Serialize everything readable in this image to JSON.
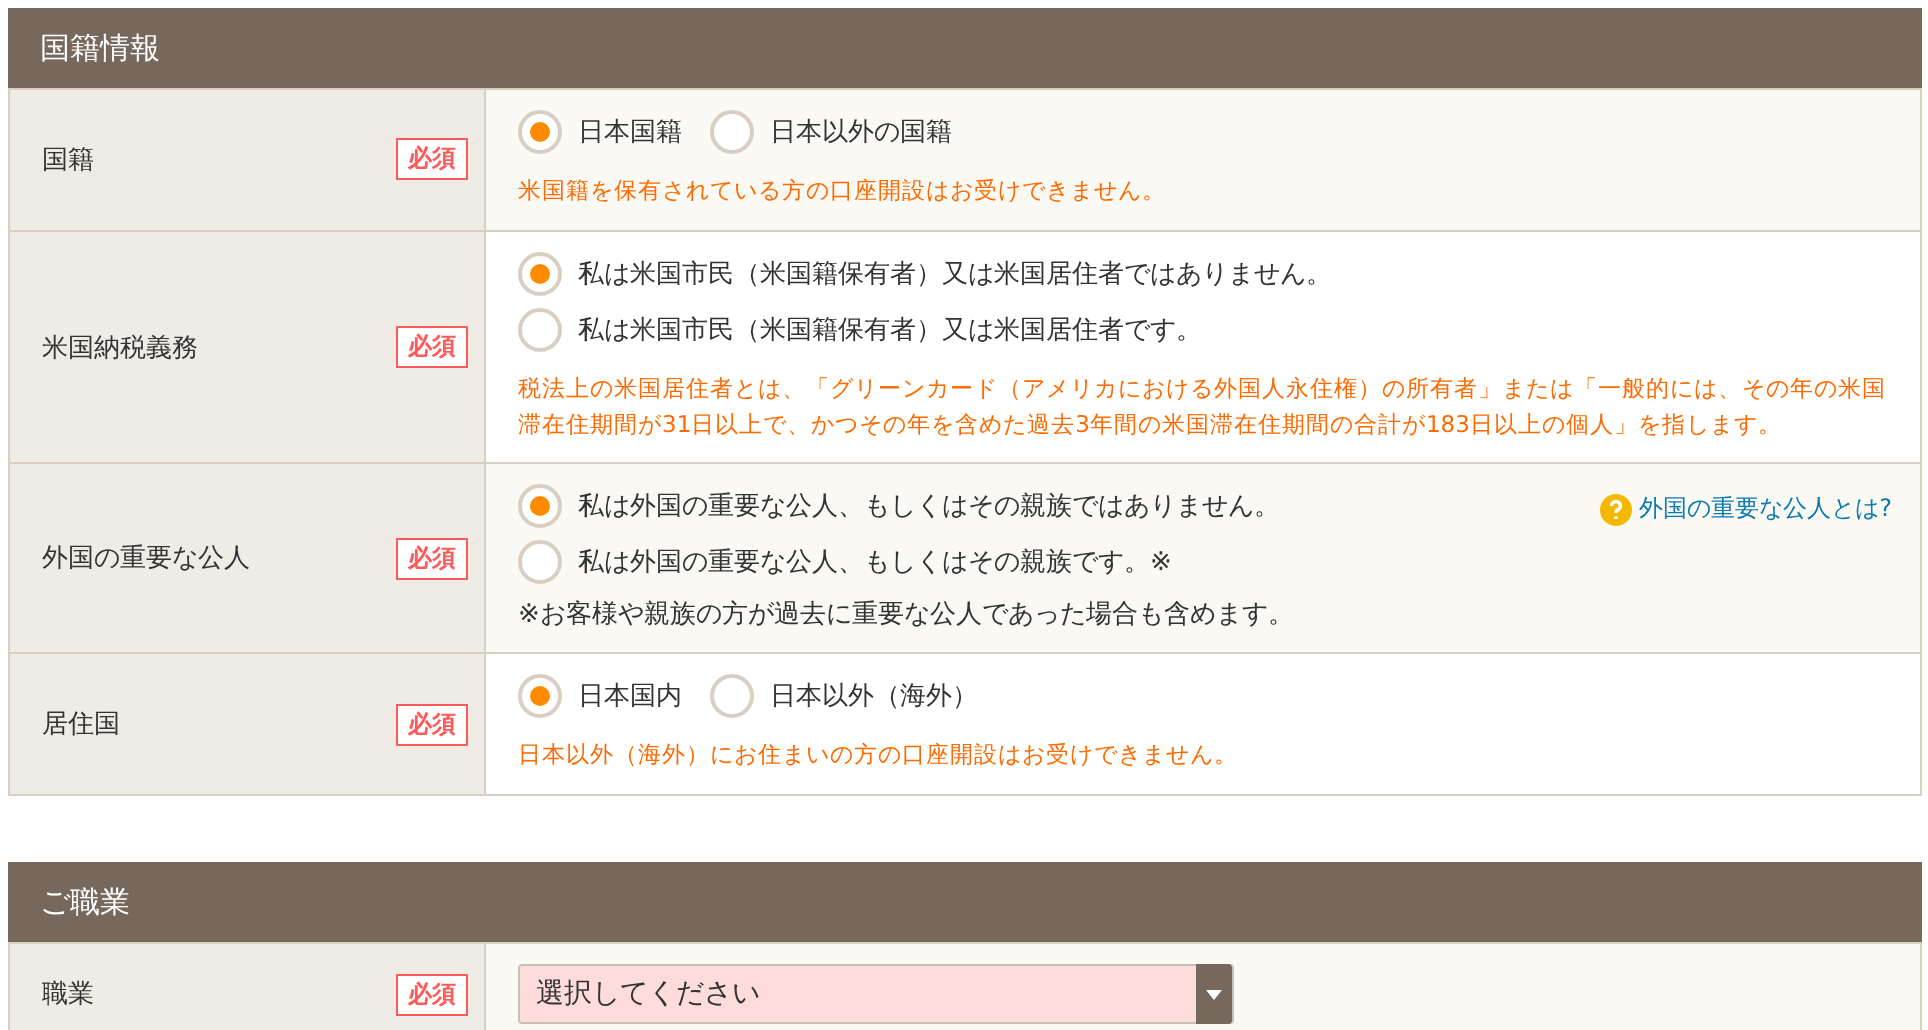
{
  "sections": [
    {
      "title": "国籍情報",
      "rows": [
        {
          "label": "国籍",
          "badge": "必須",
          "kind": "radio-inline",
          "options": [
            {
              "label": "日本国籍",
              "selected": true
            },
            {
              "label": "日本以外の国籍",
              "selected": false
            }
          ],
          "note": "米国籍を保有されている方の口座開設はお受けできません。"
        },
        {
          "label": "米国納税義務",
          "badge": "必須",
          "kind": "radio-stacked",
          "options": [
            {
              "label": "私は米国市民（米国籍保有者）又は米国居住者ではありません。",
              "selected": true
            },
            {
              "label": "私は米国市民（米国籍保有者）又は米国居住者です。",
              "selected": false
            }
          ],
          "note": "税法上の米国居住者とは、「グリーンカード（アメリカにおける外国人永住権）の所有者」または「一般的には、その年の米国滞在住期間が31日以上で、かつその年を含めた過去3年間の米国滞在住期間の合計が183日以上の個人」を指します。"
        },
        {
          "label": "外国の重要な公人",
          "badge": "必須",
          "kind": "radio-stacked",
          "options": [
            {
              "label": "私は外国の重要な公人、もしくはその親族ではありません。",
              "selected": true
            },
            {
              "label": "私は外国の重要な公人、もしくはその親族です。※",
              "selected": false
            }
          ],
          "remark": "※お客様や親族の方が過去に重要な公人であった場合も含めます。",
          "help_link": "外国の重要な公人とは?"
        },
        {
          "label": "居住国",
          "badge": "必須",
          "kind": "radio-inline",
          "options": [
            {
              "label": "日本国内",
              "selected": true
            },
            {
              "label": "日本以外（海外）",
              "selected": false
            }
          ],
          "note": "日本以外（海外）にお住まいの方の口座開設はお受けできません。"
        }
      ]
    },
    {
      "title": "ご職業",
      "rows": [
        {
          "label": "職業",
          "badge": "必須",
          "kind": "select",
          "value": "選択してください"
        }
      ]
    }
  ]
}
